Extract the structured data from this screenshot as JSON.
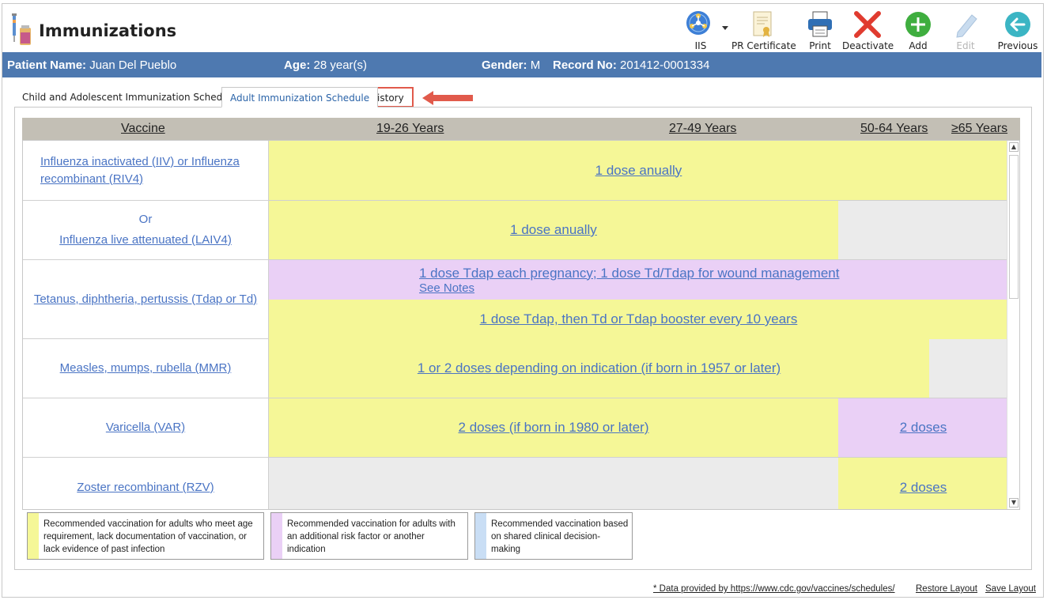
{
  "app": {
    "title": "Immunizations"
  },
  "toolbar": {
    "iis": "IIS",
    "pr_certificate": "PR Certificate",
    "print": "Print",
    "deactivate": "Deactivate",
    "add": "Add",
    "edit": "Edit",
    "previous": "Previous"
  },
  "patient": {
    "name_label": "Patient Name:",
    "name": "Juan Del Pueblo",
    "age_label": "Age:",
    "age": "28 year(s)",
    "gender_label": "Gender:",
    "gender": "M",
    "record_label": "Record No:",
    "record": "201412-0001334"
  },
  "tabs": [
    {
      "label": "Child and Adolescent Immunization Schedule"
    },
    {
      "label": "Adult Immunization Schedule",
      "active": true
    },
    {
      "label": "History",
      "highlighted": true
    }
  ],
  "schedule": {
    "columns": [
      "Vaccine",
      "19-26 Years",
      "27-49 Years",
      "50-64 Years",
      "≥65 Years"
    ],
    "rows": [
      {
        "vaccine": "Influenza inactivated (IIV) or Influenza recombinant (RIV4)",
        "recommendation": "1 dose anually"
      },
      {
        "or": "Or",
        "vaccine": "Influenza live attenuated (LAIV4)",
        "recommendation": "1 dose anually"
      },
      {
        "vaccine": "Tetanus, diphtheria, pertussis (Tdap or Td)",
        "recommendation_1": "1 dose Tdap each pregnancy; 1 dose Td/Tdap for wound management",
        "notes": "See Notes",
        "recommendation_2": "1 dose Tdap, then Td or Tdap booster every 10 years"
      },
      {
        "vaccine": "Measles, mumps, rubella (MMR)",
        "recommendation": "1 or 2 doses depending on indication (if born in 1957 or later)"
      },
      {
        "vaccine": "Varicella (VAR)",
        "recommendation_1": "2 doses (if born in 1980 or later)",
        "recommendation_2": "2 doses"
      },
      {
        "vaccine": "Zoster recombinant (RZV)",
        "recommendation": "2 doses"
      }
    ]
  },
  "legend": [
    {
      "color": "#f5f797",
      "text": "Recommended vaccination for adults who meet age requirement, lack documentation of vaccination, or lack evidence of past infection"
    },
    {
      "color": "#ead0f6",
      "text": "Recommended vaccination for adults with an additional risk factor or another indication"
    },
    {
      "color": "#c9def5",
      "text": "Recommended vaccination based on shared clinical decision-making"
    }
  ],
  "footer": {
    "source": "* Data provided by https://www.cdc.gov/vaccines/schedules/",
    "restore": "Restore Layout",
    "save": "Save Layout"
  },
  "icons": {
    "title": "immunization-icon",
    "iis": "network-globe-icon",
    "pr_certificate": "certificate-icon",
    "print": "printer-icon",
    "deactivate": "red-x-icon",
    "add": "plus-circle-icon",
    "edit": "pencil-icon",
    "previous": "arrow-left-circle-icon"
  },
  "colors": {
    "patient_bar": "#4e79b0",
    "link": "#4a74c4",
    "highlight": "#e15a4b",
    "header_bg": "#c3bfb5"
  }
}
